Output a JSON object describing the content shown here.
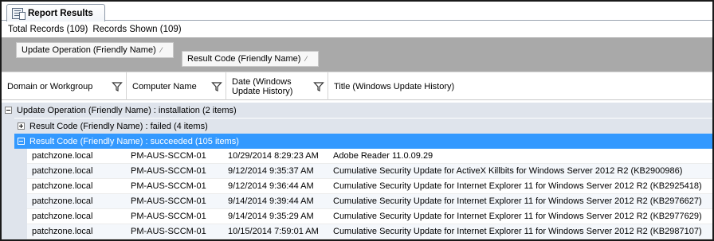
{
  "tab": {
    "label": "Report Results",
    "icon": "report-icon"
  },
  "records": {
    "total": "Total Records (109)",
    "shown": "Records Shown (109)"
  },
  "group_by": [
    {
      "label": "Update Operation (Friendly Name)",
      "sort_icon": "sort-indicator-icon"
    },
    {
      "label": "Result Code (Friendly Name)",
      "sort_icon": "sort-indicator-icon"
    }
  ],
  "columns": [
    {
      "label": "Domain or Workgroup",
      "filter_icon": "filter-icon"
    },
    {
      "label": "Computer Name",
      "filter_icon": "filter-icon"
    },
    {
      "label": "Date (Windows Update History)",
      "filter_icon": "filter-icon"
    },
    {
      "label": "Title (Windows Update History)"
    }
  ],
  "groups": {
    "level1": {
      "label": "Update Operation (Friendly Name) : installation (2 items)",
      "state": "expanded"
    },
    "failed": {
      "label": "Result Code (Friendly Name) : failed (4 items)",
      "state": "collapsed"
    },
    "succeeded": {
      "label": "Result Code (Friendly Name) : succeeded (105 items)",
      "state": "expanded",
      "selected": true
    }
  },
  "rows": [
    {
      "domain": "patchzone.local",
      "computer": "PM-AUS-SCCM-01",
      "date": "10/29/2014 8:29:23 AM",
      "title": "Adobe Reader 11.0.09.29"
    },
    {
      "domain": "patchzone.local",
      "computer": "PM-AUS-SCCM-01",
      "date": "9/12/2014 9:35:37 AM",
      "title": "Cumulative Security Update for ActiveX Killbits for Windows Server 2012 R2 (KB2900986)"
    },
    {
      "domain": "patchzone.local",
      "computer": "PM-AUS-SCCM-01",
      "date": "9/12/2014 9:36:44 AM",
      "title": "Cumulative Security Update for Internet Explorer 11 for Windows Server 2012 R2 (KB2925418)"
    },
    {
      "domain": "patchzone.local",
      "computer": "PM-AUS-SCCM-01",
      "date": "9/14/2014 9:39:44 AM",
      "title": "Cumulative Security Update for Internet Explorer 11 for Windows Server 2012 R2 (KB2976627)"
    },
    {
      "domain": "patchzone.local",
      "computer": "PM-AUS-SCCM-01",
      "date": "9/14/2014 9:35:29 AM",
      "title": "Cumulative Security Update for Internet Explorer 11 for Windows Server 2012 R2 (KB2977629)"
    },
    {
      "domain": "patchzone.local",
      "computer": "PM-AUS-SCCM-01",
      "date": "10/15/2014 7:59:01 AM",
      "title": "Cumulative Security Update for Internet Explorer 11 for Windows Server 2012 R2 (KB2987107)"
    }
  ],
  "colors": {
    "selection": "#3399ff",
    "group_bg": "#dfe4ec",
    "groupby_area": "#a9a9a9"
  }
}
